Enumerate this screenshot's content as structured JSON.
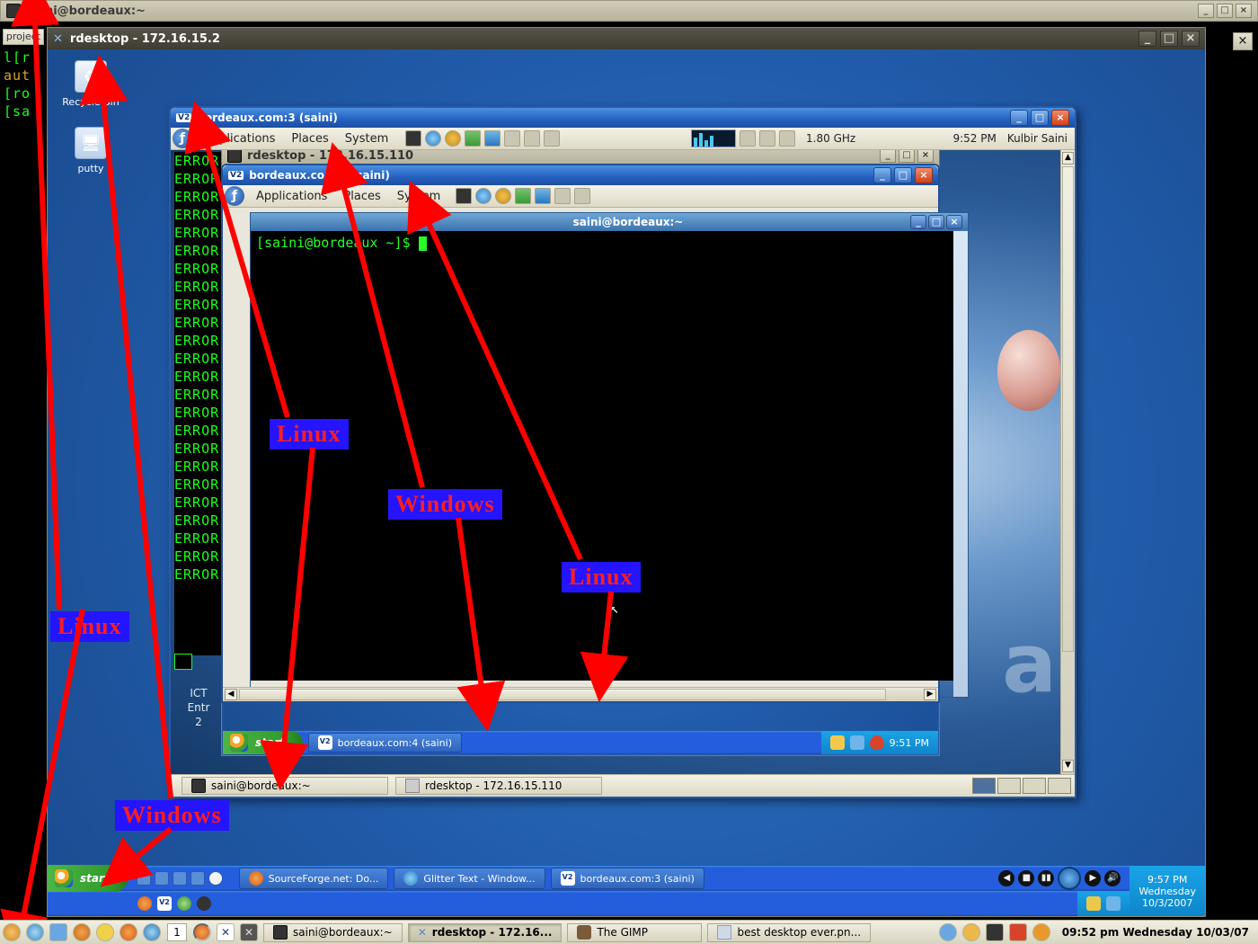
{
  "host_linux": {
    "titlebar": "saini@bordeaux:~",
    "panel_tasks": [
      {
        "label": "saini@bordeaux:~"
      },
      {
        "label": "rdesktop - 172.16..."
      },
      {
        "label": "The GIMP"
      },
      {
        "label": "best desktop ever.pn..."
      }
    ],
    "panel_workspace": "1",
    "panel_clock": "09:52 pm  Wednesday 10/03/07",
    "project_tab": "project"
  },
  "outer_term_lines": [
    "l[r",
    "aut",
    "[ro",
    "[sa",
    ""
  ],
  "outer_rdesktop": {
    "title": "rdesktop - 172.16.15.2",
    "icons": {
      "recycle": "Recycle Bin",
      "putty": "putty"
    },
    "taskbar": {
      "start": "start",
      "tasks": [
        {
          "label": "SourceForge.net: Do..."
        },
        {
          "label": "Glitter Text - Window..."
        },
        {
          "label": "bordeaux.com:3 (saini)"
        }
      ],
      "clock": {
        "time": "9:57 PM",
        "day": "Wednesday",
        "date": "10/3/2007"
      }
    }
  },
  "vnc1": {
    "title": "bordeaux.com:3 (saini)",
    "gnome_menus": [
      "Applications",
      "Places",
      "System"
    ],
    "cpu": "1.80 GHz",
    "clock": "9:52 PM",
    "user": "Kulbir Saini",
    "error_line": "ERROR",
    "ict": {
      "l1": "ICT",
      "l2": "Entr",
      "l3": "2"
    },
    "footer_tasks": [
      {
        "label": "saini@bordeaux:~"
      },
      {
        "label": "rdesktop - 172.16.15.110"
      }
    ]
  },
  "inner_rdesktop": {
    "title": "rdesktop - 172.16.15.110",
    "taskbar": {
      "start": "start",
      "task": "bordeaux.com:4 (saini)",
      "clock": "9:51 PM"
    }
  },
  "vnc2": {
    "title": "bordeaux.com:4 (saini)",
    "gnome_menus": [
      "Applications",
      "Places",
      "System"
    ]
  },
  "inner_term": {
    "title": "saini@bordeaux:~",
    "prompt": "[saini@bordeaux ~]$ "
  },
  "annotations": {
    "linux1": "Linux",
    "windows1": "Windows",
    "linux2": "Linux",
    "windows2": "Windows",
    "linux3": "Linux"
  }
}
